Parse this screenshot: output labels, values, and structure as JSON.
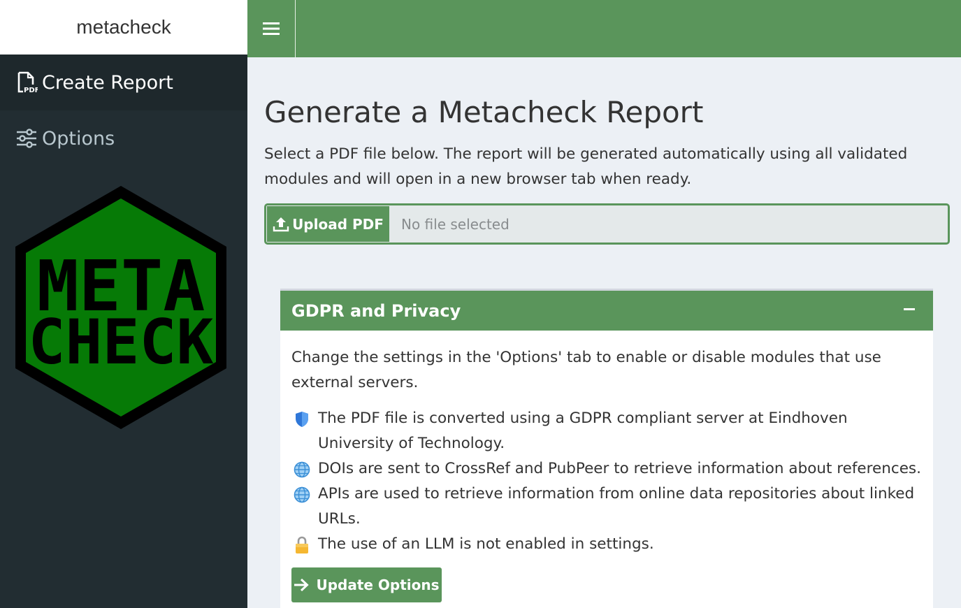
{
  "app": {
    "brand": "metacheck",
    "accent_color": "#5a955b",
    "sidebar_color": "#222d32"
  },
  "sidebar": {
    "items": [
      {
        "label": "Create Report",
        "icon": "file-pdf-icon",
        "active": true
      },
      {
        "label": "Options",
        "icon": "sliders-icon",
        "active": false
      }
    ],
    "logo": {
      "line1": "META",
      "line2": "CHECK"
    }
  },
  "header": {
    "toggle_icon": "hamburger-menu-icon"
  },
  "main": {
    "title": "Generate a Metacheck Report",
    "intro": "Select a PDF file below. The report will be generated automatically using all validated modules and will open in a new browser tab when ready.",
    "upload": {
      "button_label": "Upload PDF",
      "placeholder": "No file selected"
    }
  },
  "privacy_box": {
    "title": "GDPR and Privacy",
    "intro": "Change the settings in the 'Options' tab to enable or disable modules that use external servers.",
    "items": [
      {
        "icon": "shield-icon",
        "text": "The PDF file is converted using a GDPR compliant server at Eindhoven University of Technology."
      },
      {
        "icon": "globe-icon",
        "text": "DOIs are sent to CrossRef and PubPeer to retrieve information about references."
      },
      {
        "icon": "globe-icon",
        "text": "APIs are used to retrieve information from online data repositories about linked URLs."
      },
      {
        "icon": "lock-icon",
        "text": "The use of an LLM is not enabled in settings."
      }
    ],
    "update_button": "Update Options"
  }
}
